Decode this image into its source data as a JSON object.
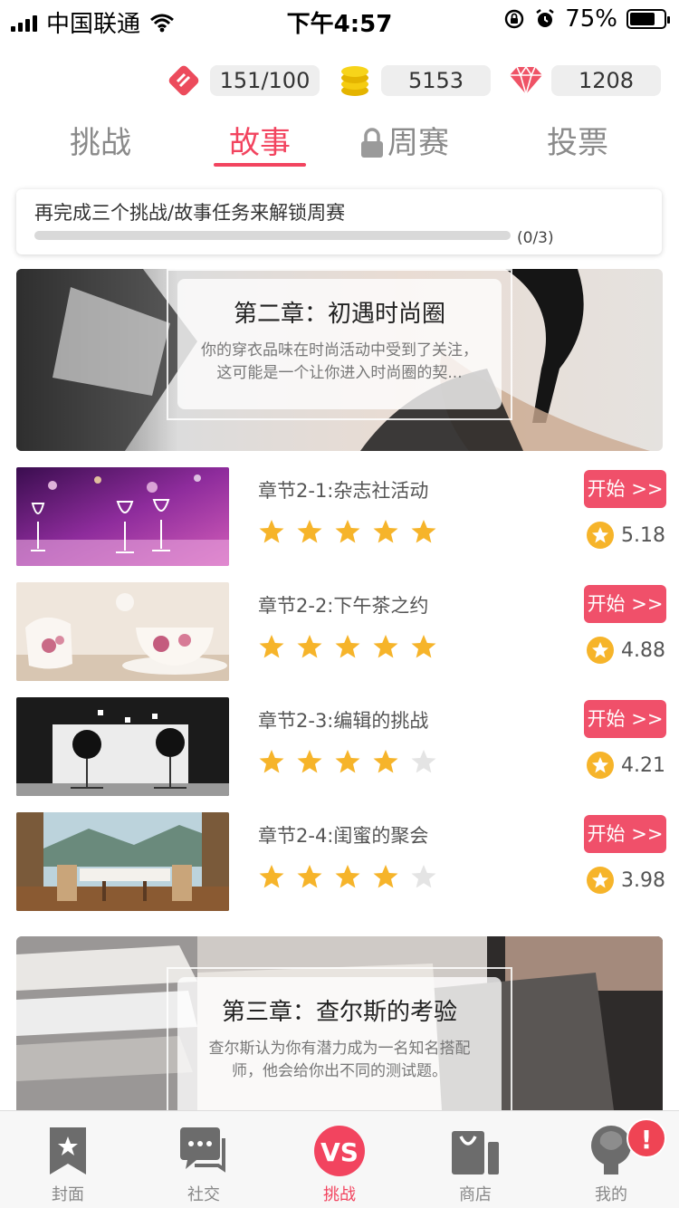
{
  "status_bar": {
    "carrier": "中国联通",
    "time": "下午4:57",
    "battery": "75%",
    "battery_level": 0.75
  },
  "currency": {
    "energy": "151/100",
    "coins": "5153",
    "gems": "1208"
  },
  "tabs": [
    "挑战",
    "故事",
    "周赛",
    "投票"
  ],
  "active_tab": "故事",
  "unlock": {
    "text": "再完成三个挑战/故事任务来解锁周赛",
    "progress_text": "(0/3)",
    "progress": 0
  },
  "chapter2": {
    "title": "第二章：初遇时尚圈",
    "desc": "你的穿衣品味在时尚活动中受到了关注，这可能是一个让你进入时尚圈的契..."
  },
  "chapter3": {
    "title": "第三章：查尔斯的考验",
    "desc": "查尔斯认为你有潜力成为一名知名搭配师，他会给你出不同的测试题。"
  },
  "sections": [
    {
      "title": "章节2-1:杂志社活动",
      "button": "开始 >>",
      "score": "5.18",
      "stars": 5
    },
    {
      "title": "章节2-2:下午茶之约",
      "button": "开始 >>",
      "score": "4.88",
      "stars": 5
    },
    {
      "title": "章节2-3:编辑的挑战",
      "button": "开始 >>",
      "score": "4.21",
      "stars": 4
    },
    {
      "title": "章节2-4:闺蜜的聚会",
      "button": "开始 >>",
      "score": "3.98",
      "stars": 4
    }
  ],
  "nav": {
    "items": [
      "封面",
      "社交",
      "挑战",
      "商店",
      "我的"
    ],
    "active": "挑战",
    "vs_text": "VS",
    "badge": "!"
  },
  "colors": {
    "accent": "#f2445f",
    "star": "#f6b42a"
  }
}
